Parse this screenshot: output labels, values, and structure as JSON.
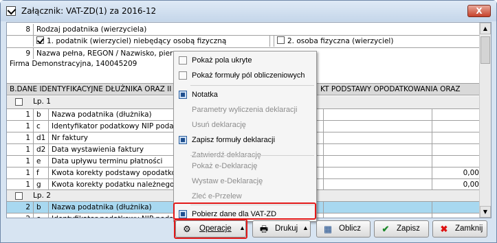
{
  "window": {
    "title": "Załącznik: VAT-ZD(1) za 2016-12",
    "close_label": "X"
  },
  "form": {
    "row8": {
      "num": "8",
      "label": "Rodzaj podatnika (wierzyciela)",
      "opt1": "1. podatnik (wierzyciel) niebędący osobą fizyczną",
      "opt2": "2. osoba fizyczna (wierzyciel)"
    },
    "row9": {
      "num": "9",
      "label": "Nazwa pełna, REGON / Nazwisko, pierwsz",
      "value": "Firma Demonstracyjna, 140045209"
    },
    "sectionB": {
      "left": "B.DANE IDENTYFIKACYJNE DŁUŻNIKA ORAZ II",
      "right": "KT PODSTAWY OPODATKOWANIA ORAZ"
    },
    "lp1": {
      "label": "Lp. 1",
      "rows": [
        {
          "n": "1",
          "code": "b",
          "label": "Nazwa podatnika (dłużnika)",
          "value": ""
        },
        {
          "n": "1",
          "code": "c",
          "label": "Identyfikator podatkowy NIP podatnik",
          "value": ""
        },
        {
          "n": "1",
          "code": "d1",
          "label": "Nr faktury",
          "value": ""
        },
        {
          "n": "1",
          "code": "d2",
          "label": "Data wystawienia faktury",
          "value": ""
        },
        {
          "n": "1",
          "code": "e",
          "label": "Data upływu terminu płatności",
          "value": ""
        },
        {
          "n": "1",
          "code": "f",
          "label": "Kwota korekty podstawy opodatkowar",
          "value": "0,00"
        },
        {
          "n": "1",
          "code": "g",
          "label": "Kwota korekty podatku należnego",
          "value": "0,00"
        }
      ]
    },
    "lp2": {
      "label": "Lp. 2",
      "rows": [
        {
          "n": "2",
          "code": "b",
          "label": "Nazwa podatnika (dłużnika)",
          "value": ""
        },
        {
          "n": "2",
          "code": "c",
          "label": "Identyfikator podatkowy NIP podatnik",
          "value": ""
        }
      ]
    }
  },
  "context_menu": {
    "items": [
      {
        "label": "Pokaż pola ukryte",
        "enabled": true,
        "checked": false
      },
      {
        "label": "Pokaż formuły pól obliczeniowych",
        "enabled": true,
        "checked": false
      },
      {
        "label": "Notatka",
        "enabled": true,
        "checked": true
      },
      {
        "label": "Parametry wyliczenia deklaracji",
        "enabled": false
      },
      {
        "label": "Usuń deklarację",
        "enabled": false
      },
      {
        "label": "Zapisz formuły deklaracji",
        "enabled": true,
        "checked": true
      },
      {
        "label": "Zatwierdź deklarację",
        "enabled": false
      },
      {
        "label": "Pokaż e-Deklarację",
        "enabled": false
      },
      {
        "label": "Wystaw e-Deklarację",
        "enabled": false
      },
      {
        "label": "Zleć e-Przelew",
        "enabled": false
      },
      {
        "label": "Pobierz dane dla VAT-ZD",
        "enabled": true,
        "checked": true
      }
    ]
  },
  "buttons": {
    "operacje": "Operacje",
    "drukuj": "Drukuj",
    "oblicz": "Oblicz",
    "zapisz": "Zapisz",
    "zamknij": "Zamknij"
  },
  "colors": {
    "highlight_row": "#a8d8f0",
    "accent_red": "#e21818",
    "section_bg": "#d9d9d9"
  }
}
